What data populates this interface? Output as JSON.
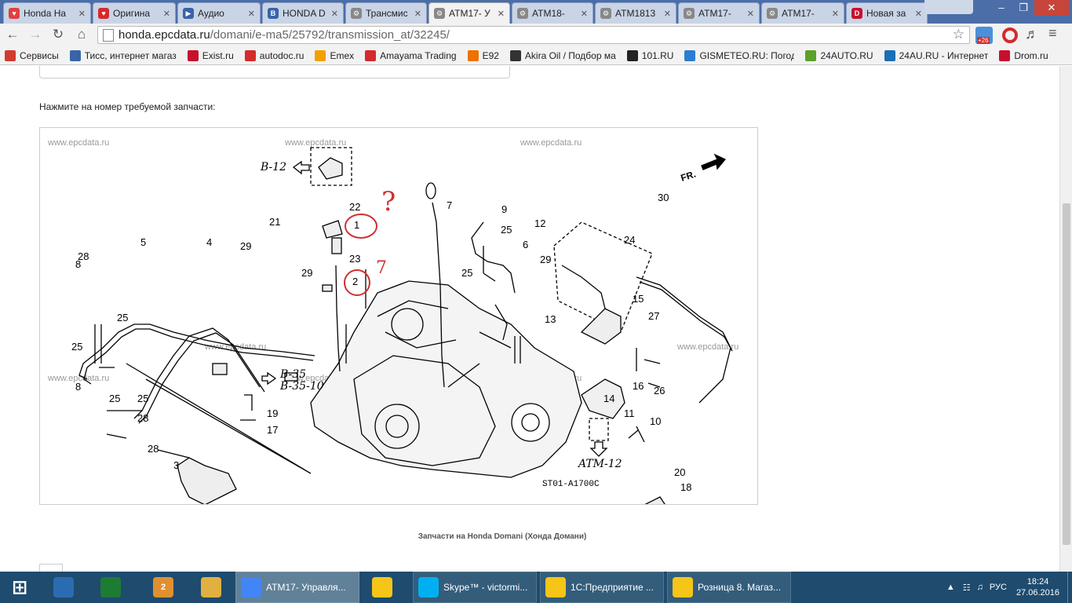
{
  "tabs": [
    {
      "label": "Honda Ha",
      "color": "#e04040",
      "glyph": "♥"
    },
    {
      "label": "Оригина",
      "color": "#d42b2b",
      "glyph": "♥"
    },
    {
      "label": "Аудио",
      "color": "#3a64a8",
      "glyph": "▶"
    },
    {
      "label": "HONDA D",
      "color": "#3a64a8",
      "glyph": "B"
    },
    {
      "label": "Трансмис",
      "color": "#888888",
      "glyph": "⚙"
    },
    {
      "label": "ATM17- У",
      "color": "#888888",
      "glyph": "⚙",
      "active": true
    },
    {
      "label": "ATM18-",
      "color": "#888888",
      "glyph": "⚙"
    },
    {
      "label": "ATM1813",
      "color": "#888888",
      "glyph": "⚙"
    },
    {
      "label": "ATM17- ",
      "color": "#888888",
      "glyph": "⚙"
    },
    {
      "label": "ATM17- ",
      "color": "#888888",
      "glyph": "⚙"
    },
    {
      "label": "Новая за",
      "color": "#c8102e",
      "glyph": "D"
    }
  ],
  "address_bar": {
    "host": "honda.epcdata.ru",
    "path": "/domani/e-ma5/25792/transmission_at/32245/"
  },
  "bookmarks": [
    {
      "label": "Сервисы",
      "color": "#d13b2f"
    },
    {
      "label": "Тисс, интернет магаз",
      "color": "#3a64a8"
    },
    {
      "label": "Exist.ru",
      "color": "#c8102e"
    },
    {
      "label": "autodoc.ru",
      "color": "#d42b2b"
    },
    {
      "label": "Emex",
      "color": "#f0a000"
    },
    {
      "label": "Amayama Trading",
      "color": "#d42b2b"
    },
    {
      "label": "E92",
      "color": "#f07000"
    },
    {
      "label": "Akira Oil / Подбор ма",
      "color": "#333333"
    },
    {
      "label": "101.RU",
      "color": "#222222"
    },
    {
      "label": "GISMETEO.RU: Погод",
      "color": "#2a7dd2"
    },
    {
      "label": "24AUTO.RU",
      "color": "#5aa02c"
    },
    {
      "label": "24AU.RU - Интернет",
      "color": "#1a6fb5"
    },
    {
      "label": "Drom.ru",
      "color": "#c8102e"
    }
  ],
  "page": {
    "instruction": "Нажмите на номер требуемой запчасти:",
    "caption": "Запчасти на Honda Domani (Хонда Домани)",
    "watermark": "www.epcdata.ru",
    "diagram_code": "ST01-A1700C",
    "refs": {
      "b12": "B-12",
      "b35": "B-35",
      "b3510": "B-35-10",
      "atm12": "ATM-12",
      "fr": "FR."
    },
    "part_numbers": [
      "1",
      "2",
      "3",
      "4",
      "5",
      "6",
      "7",
      "8",
      "9",
      "10",
      "11",
      "12",
      "13",
      "14",
      "15",
      "16",
      "17",
      "18",
      "19",
      "20",
      "21",
      "22",
      "23",
      "24",
      "25",
      "26",
      "27",
      "28",
      "29",
      "30"
    ],
    "annotations": [
      "?",
      "7"
    ]
  },
  "taskbar": {
    "items": [
      {
        "label": "",
        "color": "#ffffff"
      },
      {
        "label": "",
        "color": "#2b6cb0"
      },
      {
        "label": "",
        "color": "#1e7b34"
      },
      {
        "label": "",
        "color": "#e09030"
      },
      {
        "label": "",
        "color": "#e0b040"
      },
      {
        "label": "ATM17- Управля...",
        "color": "#4285f4"
      },
      {
        "label": "",
        "color": "#f5c518"
      },
      {
        "label": "Skype™ - victormi...",
        "color": "#00aff0"
      },
      {
        "label": "1С:Предприятие ...",
        "color": "#f5c518"
      },
      {
        "label": "Розница 8. Магаз...",
        "color": "#f5c518"
      }
    ],
    "language": "РУС",
    "time": "18:24",
    "date": "27.06.2016",
    "badge": "2",
    "tray_badge": "+26"
  }
}
